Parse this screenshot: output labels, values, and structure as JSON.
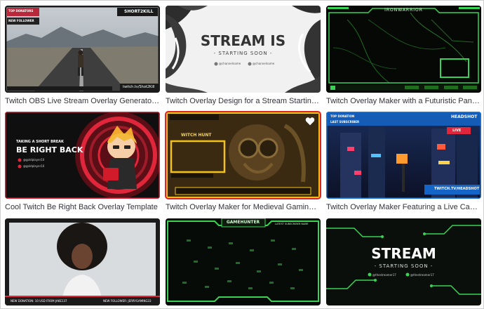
{
  "templates": [
    {
      "caption": "Twitch OBS Live Stream Overlay Generator ...",
      "overlay": {
        "top_left_1": "TOP DONATORS",
        "top_left_2": "NEW FOLLOWER",
        "top_right": "SHORT2KILL",
        "bottom_right": "twitch.tv/Shot2Kill"
      }
    },
    {
      "caption": "Twitch Overlay Design for a Stream Starting...",
      "overlay": {
        "title": "STREAM IS",
        "subtitle": "- STARTING SOON -",
        "handle_1": "@channelname",
        "handle_2": "@channelname"
      }
    },
    {
      "caption": "Twitch Overlay Maker with a Futuristic Pane...",
      "overlay": {
        "top_center": "IRONWARRIOR"
      }
    },
    {
      "caption": "Cool Twitch Be Right Back Overlay Template",
      "overlay": {
        "line_1": "TAKING A SHORT BREAK",
        "title": "BE RIGHT BACK",
        "handle_1": "@goldplayer10",
        "handle_2": "@goldplayer10"
      }
    },
    {
      "caption": "Twitch Overlay Maker for Medieval Gaming ...",
      "overlay": {
        "label": "WITCH HUNT"
      }
    },
    {
      "caption": "Twitch Overlay Maker Featuring a Live Cam ...",
      "overlay": {
        "top_left_1": "TOP DONATION",
        "top_left_2": "LAST SUBSCRIBER",
        "top_right": "HEADSHOT",
        "badge": "LIVE",
        "bottom_right": "TWITCH.TV/HEADSHOT"
      }
    },
    {
      "caption": "",
      "overlay": {
        "bottom_left": "NEW DONATION: 10 USD FROM JAKE137",
        "bottom_right": "NEW FOLLOWER: JERRYGAMING33"
      }
    },
    {
      "caption": "",
      "overlay": {
        "top_center": "GAMEHUNTER",
        "top_right": "LATEST SUBSCRIBER NAME"
      }
    },
    {
      "caption": "",
      "overlay": {
        "title": "STREAM",
        "subtitle": "- STARTING SOON -",
        "handle_1": "@thestreamer17",
        "handle_2": "@thestreamer17"
      }
    }
  ],
  "icons": {
    "favorite": "heart-icon"
  },
  "colors": {
    "selected_outline": "#d8262b",
    "neon_green": "#39d353",
    "brand_red": "#e0263a",
    "yellow": "#f2c21b"
  }
}
